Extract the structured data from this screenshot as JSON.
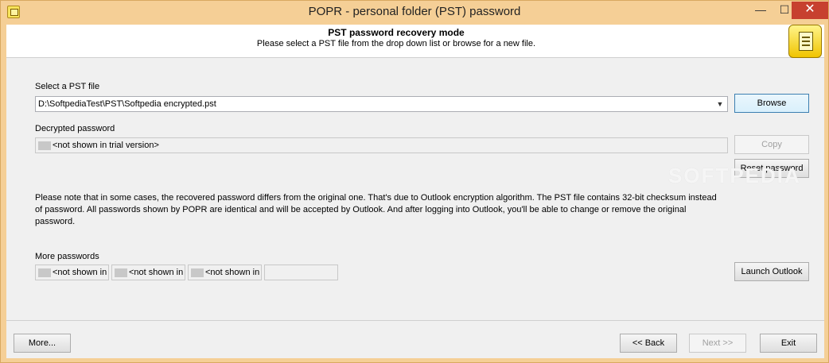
{
  "window": {
    "title": "POPR - personal folder (PST) password",
    "minimize_glyph": "—",
    "maximize_glyph": "☐",
    "close_glyph": "✕"
  },
  "header": {
    "title": "PST password recovery mode",
    "subtitle": "Please select a PST file from the drop down list or browse for a new file.",
    "icon": "pst-file-icon"
  },
  "pst_file": {
    "label": "Select a PST file",
    "value": "D:\\SoftpediaTest\\PST\\Softpedia encrypted.pst",
    "browse_label": "Browse"
  },
  "decrypted": {
    "label": "Decrypted password",
    "value": "<not shown in trial version>",
    "copy_label": "Copy",
    "reset_label": "Reset password"
  },
  "note": "Please note that in some cases, the recovered password differs from the original one. That's due to Outlook encryption algorithm. The PST file contains 32-bit checksum instead of password. All passwords shown by POPR are identical and will be accepted by Outlook. And after logging into Outlook, you'll be able to change or remove the original password.",
  "more_passwords": {
    "label": "More passwords",
    "items": [
      "<not shown in",
      "<not shown in",
      "<not shown in t",
      ""
    ],
    "launch_label": "Launch Outlook"
  },
  "watermark": "SOFTPEDIA",
  "footer": {
    "more_label": "More...",
    "back_label": "<< Back",
    "next_label": "Next >>",
    "exit_label": "Exit"
  },
  "colors": {
    "titlebar": "#f5cf96",
    "close": "#c7402f",
    "focus_border": "#3c7fb1"
  }
}
